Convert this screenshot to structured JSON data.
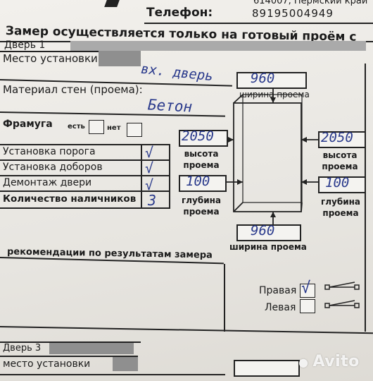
{
  "header": {
    "address_fragment": "614007, Пермский край",
    "phone_label": "Телефон:",
    "phone_value": "89195004949"
  },
  "notice": "Замер осуществляется только на готовый проём с",
  "door1": {
    "title": "Дверь 1",
    "install_place_label": "Место установки:",
    "install_place_value": "вх. дверь",
    "wall_material_label": "Материал стен (проема):",
    "wall_material_value": "Бетон",
    "framuga_label": "Фрамуга",
    "framuga_yes": "есть",
    "framuga_no": "нет",
    "tasks": [
      {
        "label": "Установка порога",
        "mark": "√"
      },
      {
        "label": "Установка доборов",
        "mark": "√"
      },
      {
        "label": "Демонтаж двери",
        "mark": "√"
      },
      {
        "label": "Количество наличников",
        "mark": "3"
      }
    ],
    "recommendations_label": "рекомендации по результатам замера",
    "opening": {
      "width_top_value": "960",
      "width_top_label": "ширина проема",
      "height_left_value": "2050",
      "height_left_label": "высота\nпроема",
      "height_right_value": "2050",
      "height_right_label": "высота\nпроема",
      "depth_left_value": "100",
      "depth_left_label": "глубина\nпроема",
      "depth_right_value": "100",
      "depth_right_label": "глубина\nпроема",
      "width_bottom_value": "960",
      "width_bottom_label": "ширина проема"
    },
    "hinge": {
      "right_label": "Правая",
      "right_mark": "√",
      "left_label": "Левая"
    }
  },
  "door3": {
    "title": "Дверь 3",
    "install_place_label": "место установки"
  },
  "watermark": "Avito"
}
